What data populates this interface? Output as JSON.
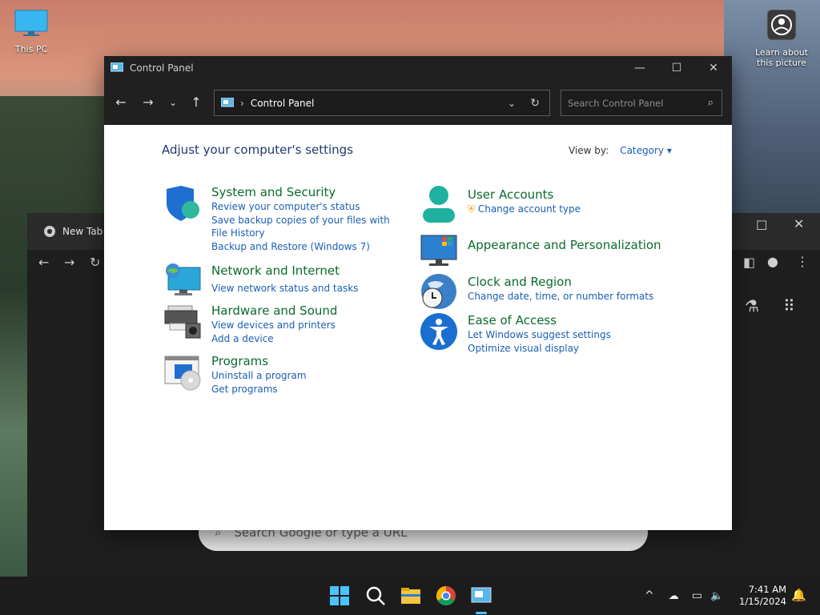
{
  "desktop": {
    "icons": [
      {
        "label": "This PC"
      },
      {
        "label": "Learn about this picture"
      }
    ]
  },
  "chrome": {
    "tab_title": "New Tab",
    "search_placeholder": "Search Google or type a URL"
  },
  "control_panel": {
    "window_title": "Control Panel",
    "address_path": "Control Panel",
    "search_placeholder": "Search Control Panel",
    "heading": "Adjust your computer's settings",
    "view_by_label": "View by:",
    "view_by_value": "Category",
    "categories": [
      {
        "title": "System and Security",
        "links": [
          "Review your computer's status",
          "Save backup copies of your files with File History",
          "Backup and Restore (Windows 7)"
        ]
      },
      {
        "title": "Network and Internet",
        "links": [
          "View network status and tasks"
        ]
      },
      {
        "title": "Hardware and Sound",
        "links": [
          "View devices and printers",
          "Add a device"
        ]
      },
      {
        "title": "Programs",
        "links": [
          "Uninstall a program",
          "Get programs"
        ]
      },
      {
        "title": "User Accounts",
        "links": [
          "Change account type"
        ]
      },
      {
        "title": "Appearance and Personalization",
        "links": []
      },
      {
        "title": "Clock and Region",
        "links": [
          "Change date, time, or number formats"
        ]
      },
      {
        "title": "Ease of Access",
        "links": [
          "Let Windows suggest settings",
          "Optimize visual display"
        ]
      }
    ]
  },
  "taskbar": {
    "time": "7:41 AM",
    "date": "1/15/2024"
  },
  "colors": {
    "category_title": "#0b6b2b",
    "link": "#1a5fb4",
    "titlebar": "#202020",
    "taskbar": "#1c1c1c"
  }
}
